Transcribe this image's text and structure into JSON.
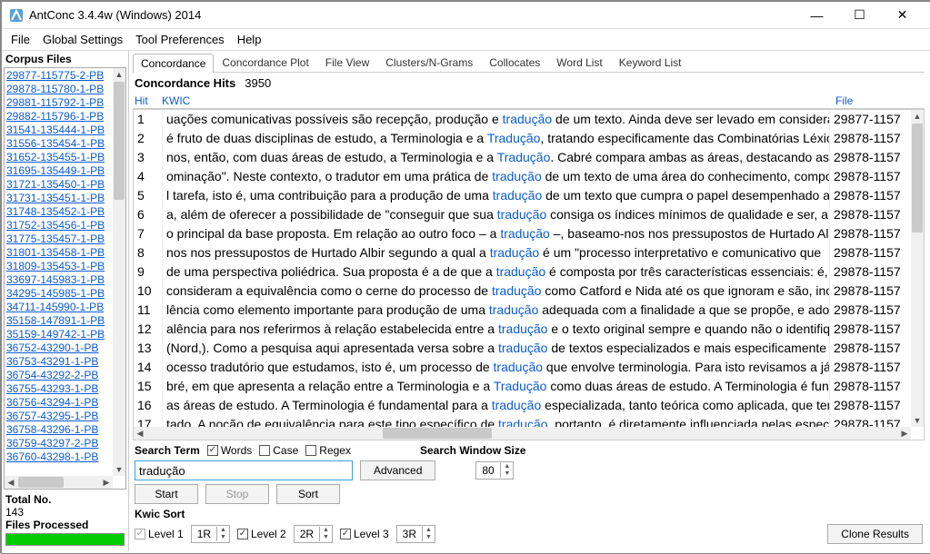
{
  "window": {
    "title": "AntConc 3.4.4w (Windows) 2014"
  },
  "menu": [
    "File",
    "Global Settings",
    "Tool Preferences",
    "Help"
  ],
  "left": {
    "corpus_label": "Corpus Files",
    "files": [
      "29877-115775-2-PB",
      "29878-115780-1-PB",
      "29881-115792-1-PB",
      "29882-115796-1-PB",
      "31541-135444-1-PB",
      "31556-135454-1-PB",
      "31652-135455-1-PB",
      "31695-135449-1-PB",
      "31721-135450-1-PB",
      "31731-135451-1-PB",
      "31748-135452-1-PB",
      "31752-135456-1-PB",
      "31775-135457-1-PB",
      "31801-135458-1-PB",
      "31809-135453-1-PB",
      "33697-145983-1-PB",
      "34295-145985-1-PB",
      "34711-145990-1-PB",
      "35158-147891-1-PB",
      "35159-149742-1-PB",
      "36752-43290-1-PB",
      "36753-43291-1-PB",
      "36754-43292-2-PB",
      "36755-43293-1-PB",
      "36756-43294-1-PB",
      "36757-43295-1-PB",
      "36758-43296-1-PB",
      "36759-43297-2-PB",
      "36760-43298-1-PB"
    ],
    "total_label": "Total No.",
    "total_value": "143",
    "processed_label": "Files Processed"
  },
  "tabs": [
    "Concordance",
    "Concordance Plot",
    "File View",
    "Clusters/N-Grams",
    "Collocates",
    "Word List",
    "Keyword List"
  ],
  "active_tab": 0,
  "hits_label": "Concordance Hits",
  "hits_value": "3950",
  "columns": {
    "hit": "Hit",
    "kwic": "KWIC",
    "file": "File"
  },
  "rows": [
    {
      "n": "1",
      "l": "uações comunicativas possíveis são recepção, produção e ",
      "k": "tradução",
      "r": " de um texto. Ainda deve ser levado em consideraçã",
      "f": "29877-1157"
    },
    {
      "n": "2",
      "l": "é fruto de duas disciplinas de estudo, a Terminologia e a ",
      "k": "Tradução",
      "r": ", tratando especificamente das Combinatórias Léxic",
      "f": "29878-1157"
    },
    {
      "n": "3",
      "l": "nos, então, com duas áreas de estudo, a Terminologia e a ",
      "k": "Tradução",
      "r": ". Cabré compara ambas as áreas, destacando as car",
      "f": "29878-1157"
    },
    {
      "n": "4",
      "l": "ominação\". Neste contexto, o tradutor em uma prática de ",
      "k": "tradução",
      "r": " de um texto de uma área do conhecimento, compo",
      "f": "29878-1157"
    },
    {
      "n": "5",
      "l": "l tarefa, isto é, uma contribuição para a produção de uma ",
      "k": "tradução",
      "r": " de um texto que cumpra o papel desempenhado a",
      "f": "29878-1157"
    },
    {
      "n": "6",
      "l": "a, além de oferecer a possibilidade de \"conseguir que sua ",
      "k": "tradução",
      "r": " consiga os índices mínimos de qualidade e ser, alé",
      "f": "29878-1157"
    },
    {
      "n": "7",
      "l": "o principal da base proposta. Em relação ao outro foco – a ",
      "k": "tradução",
      "r": " –, baseamo-nos nos pressupostos de Hurtado Albir",
      "f": "29878-1157"
    },
    {
      "n": "8",
      "l": "nos nos pressupostos de Hurtado Albir  segundo a qual a ",
      "k": "tradução",
      "r": " é um \"processo interpretativo e comunicativo que",
      "f": "29878-1157"
    },
    {
      "n": "9",
      "l": "de uma perspectiva poliédrica. Sua proposta é a de que a ",
      "k": "tradução",
      "r": " é composta por três características essenciais: é, ac",
      "f": "29878-1157"
    },
    {
      "n": "10",
      "l": "consideram a equivalência como o cerne do processo de ",
      "k": "tradução",
      "r": " como Catford e Nida até os que ignoram e são, inc",
      "f": "29878-1157"
    },
    {
      "n": "11",
      "l": "lência como elemento importante para produção de uma ",
      "k": "tradução",
      "r": " adequada com a finalidade a que se propõe, e ado",
      "f": "29878-1157"
    },
    {
      "n": "12",
      "l": "alência para nos referirmos à relação estabelecida entre a ",
      "k": "tradução",
      "r": " e o texto original sempre e quando não o identifiqu",
      "f": "29878-1157"
    },
    {
      "n": "13",
      "l": "(Nord,). Como a pesquisa aqui apresentada versa sobre a ",
      "k": "tradução",
      "r": " de textos especializados e mais especificamente so",
      "f": "29878-1157"
    },
    {
      "n": "14",
      "l": "ocesso tradutório que estudamos, isto é, um processo de ",
      "k": "tradução",
      "r": " que envolve terminologia. Para isto revisamos a já",
      "f": "29878-1157"
    },
    {
      "n": "15",
      "l": "bré, em que apresenta a relação entre a Terminologia e a ",
      "k": "Tradução",
      "r": " como duas áreas de estudo. A Terminologia é func",
      "f": "29878-1157"
    },
    {
      "n": "16",
      "l": "as áreas de estudo. A Terminologia é fundamental para a ",
      "k": "tradução",
      "r": " especializada, tanto teórica como aplicada, que ten",
      "f": "29878-1157"
    },
    {
      "n": "17",
      "l": "tado. A noção de equivalência para este tipo específico de ",
      "k": "tradução",
      "r": ", portanto, é diretamente influenciada pelas especifi",
      "f": "29878-1157"
    }
  ],
  "search": {
    "term_label": "Search Term",
    "words": "Words",
    "case": "Case",
    "regex": "Regex",
    "value": "tradução",
    "advanced": "Advanced",
    "window_label": "Search Window Size",
    "window_value": "80",
    "start": "Start",
    "stop": "Stop",
    "sort": "Sort"
  },
  "kwic": {
    "label": "Kwic Sort",
    "l1": "Level 1",
    "v1": "1R",
    "l2": "Level 2",
    "v2": "2R",
    "l3": "Level 3",
    "v3": "3R"
  },
  "clone": "Clone Results"
}
